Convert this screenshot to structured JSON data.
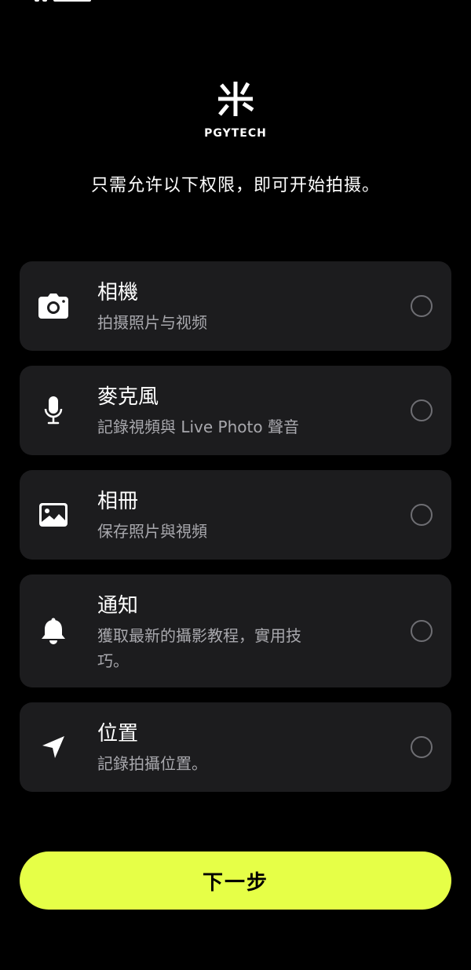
{
  "brand": {
    "logo_text": "PGYTECH"
  },
  "intro_text": "只需允许以下权限，即可开始拍摄。",
  "permissions": [
    {
      "title": "相機",
      "desc": "拍摄照片与视频",
      "icon": "camera-icon"
    },
    {
      "title": "麥克風",
      "desc": "記錄視頻與 Live Photo 聲音",
      "icon": "microphone-icon"
    },
    {
      "title": "相冊",
      "desc": "保存照片與視頻",
      "icon": "photo-library-icon"
    },
    {
      "title": "通知",
      "desc": "獲取最新的攝影教程，實用技巧。",
      "icon": "bell-icon"
    },
    {
      "title": "位置",
      "desc": "記錄拍攝位置。",
      "icon": "location-arrow-icon"
    }
  ],
  "next_button_label": "下一步",
  "colors": {
    "background": "#000000",
    "card": "#1c1c1e",
    "accent": "#e6ff47",
    "secondary_text": "#a8a8ad"
  }
}
